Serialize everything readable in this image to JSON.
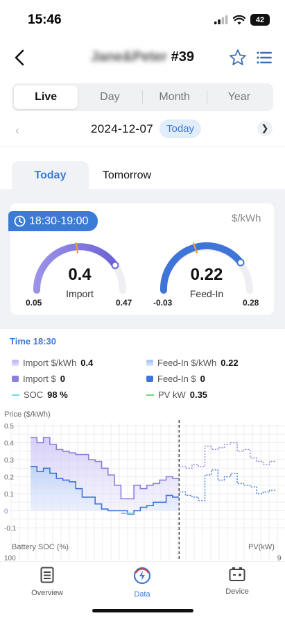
{
  "status": {
    "time": "15:46",
    "battery": "42"
  },
  "header": {
    "title_blur": "Jane&Peter",
    "title_suffix": "#39"
  },
  "range_tabs": [
    "Live",
    "Day",
    "Month",
    "Year"
  ],
  "date": {
    "value": "2024-12-07",
    "today_button": "Today"
  },
  "day_tabs": {
    "today": "Today",
    "tomorrow": "Tomorrow"
  },
  "price_card": {
    "time_range": "18:30-19:00",
    "unit": "$/kWh",
    "import": {
      "value": "0.4",
      "label": "Import",
      "min": "0.05",
      "max": "0.47"
    },
    "feed_in": {
      "value": "0.22",
      "label": "Feed-In",
      "min": "-0.03",
      "max": "0.28"
    }
  },
  "legend": {
    "time": "Time 18:30",
    "import_rate_label": "Import $/kWh",
    "import_rate_value": "0.4",
    "feedin_rate_label": "Feed-In $/kWh",
    "feedin_rate_value": "0.22",
    "import_cost_label": "Import $",
    "import_cost_value": "0",
    "feedin_cost_label": "Feed-In $",
    "feedin_cost_value": "0",
    "soc_label": "SOC",
    "soc_value": "98 %",
    "pv_label": "PV kW",
    "pv_value": "0.35"
  },
  "chart": {
    "ylabel": "Price ($/kWh)",
    "y_ticks": [
      "0.5",
      "0.4",
      "0.3",
      "0.2",
      "0.1",
      "0",
      "-0.1"
    ],
    "soc_label": "Battery SOC (%)",
    "pv_label": "PV(kW)",
    "soc_tick": "100",
    "pv_tick": "9"
  },
  "chart_data": {
    "type": "line",
    "ylabel": "Price ($/kWh)",
    "ylim": [
      -0.1,
      0.5
    ],
    "now_index": 23,
    "series": [
      {
        "name": "Import $/kWh",
        "values": [
          0.43,
          0.4,
          0.43,
          0.39,
          0.36,
          0.35,
          0.34,
          0.33,
          0.33,
          0.3,
          0.29,
          0.25,
          0.21,
          0.15,
          0.07,
          0.07,
          0.15,
          0.13,
          0.15,
          0.16,
          0.18,
          0.2,
          0.19,
          0.26,
          0.25,
          0.27,
          0.26,
          0.38,
          0.36,
          0.37,
          0.39,
          0.4,
          0.35,
          0.36,
          0.31,
          0.29,
          0.27,
          0.29
        ]
      },
      {
        "name": "Feed-In $/kWh",
        "values": [
          0.26,
          0.23,
          0.25,
          0.22,
          0.19,
          0.18,
          0.17,
          0.13,
          0.08,
          0.08,
          0.04,
          0.01,
          0.0,
          0.0,
          0.0,
          -0.02,
          0.0,
          0.02,
          0.03,
          0.05,
          0.05,
          0.09,
          0.08,
          0.11,
          0.09,
          0.08,
          0.06,
          0.21,
          0.24,
          0.18,
          0.2,
          0.22,
          0.16,
          0.15,
          0.14,
          0.1,
          0.11,
          0.12
        ]
      }
    ]
  },
  "nav": {
    "overview": "Overview",
    "data": "Data",
    "device": "Device"
  },
  "colors": {
    "accent": "#3a7bd5",
    "import": "#8b7fe0",
    "feedin": "#3f74d8",
    "soc": "#6fd6e6",
    "pv": "#6ddc7b"
  }
}
